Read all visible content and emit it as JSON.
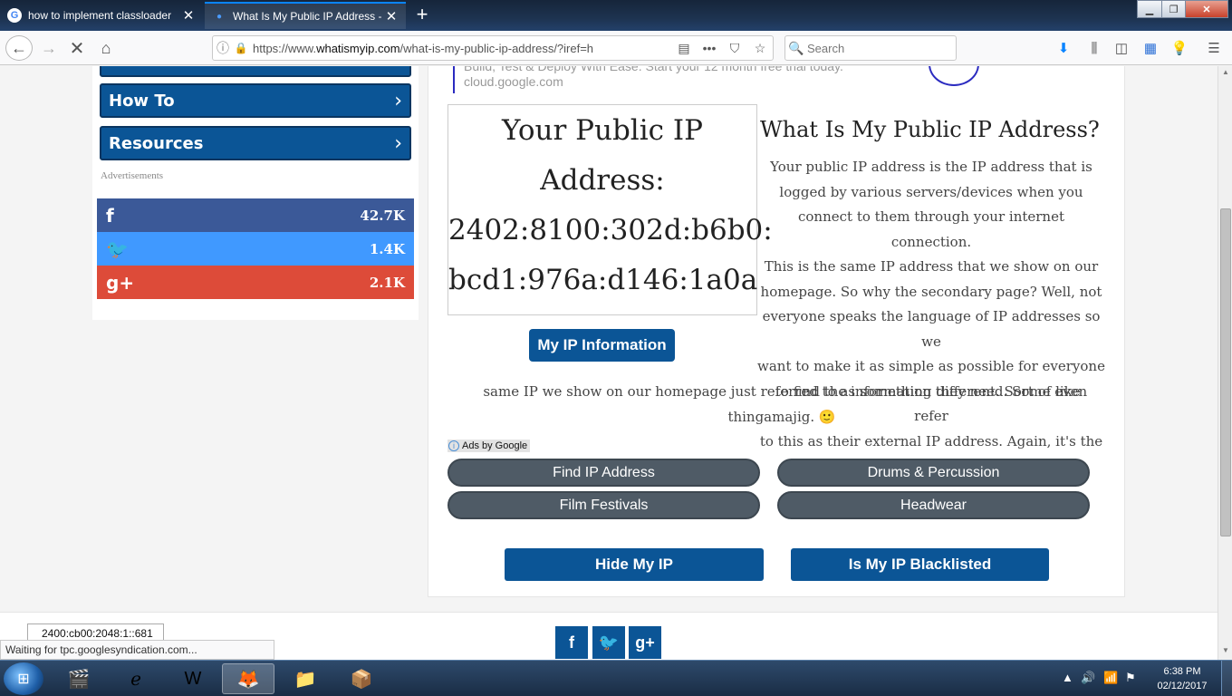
{
  "browser": {
    "tabs": [
      {
        "title": "how to implement classloader",
        "favicon": "G",
        "active": false
      },
      {
        "title": "What Is My Public IP Address -",
        "active": true
      }
    ],
    "url_prefix": "https://www.",
    "url_domain": "whatismyip.com",
    "url_rest": "/what-is-my-public-ip-address/?iref=h",
    "search_placeholder": "Search",
    "more_icon": "•••",
    "status_text": "Waiting for tpc.googlesyndication.com..."
  },
  "sidebar": {
    "nav_items": [
      {
        "label": "How To"
      },
      {
        "label": "Resources"
      }
    ],
    "ads_label": "Advertisements",
    "share": [
      {
        "network": "facebook",
        "icon": "f",
        "count": "42.7K",
        "color": "#3b5998"
      },
      {
        "network": "twitter",
        "icon": "🐦",
        "count": "1.4K",
        "color": "#4099ff"
      },
      {
        "network": "google-plus",
        "icon": "g+",
        "count": "2.1K",
        "color": "#dd4b39"
      }
    ]
  },
  "main": {
    "top_ad": {
      "line1": "Build, Test & Deploy With Ease. Start your 12 month free trial today.",
      "line2": "cloud.google.com"
    },
    "ip_box": {
      "line1": "Your Public IP",
      "line2": "Address:",
      "line3": "2402:8100:302d:b6b0:",
      "line4": "bcd1:976a:d146:1a0a"
    },
    "my_ip_button": "My IP Information",
    "heading": "What Is My Public IP Address?",
    "para_lines_a": [
      "Your public IP address is the IP address that is",
      "logged by various servers/devices when you",
      "connect to them through your internet connection.",
      "This is the same IP address that we show on our",
      "homepage. So why the secondary page? Well, not",
      "everyone speaks the language of IP addresses so we",
      "want to make it as simple as possible for everyone",
      "to find the information they need. Some even refer",
      "to this as their external IP address. Again, it's the"
    ],
    "para_lines_b": [
      "same IP we show on our homepage just referred to as something different. Sort of like",
      "thingamajig. 🙂"
    ],
    "ads_by": "Ads by Google",
    "ad_links": [
      "Find IP Address",
      "Drums & Percussion",
      "Film Festivals",
      "Headwear"
    ],
    "buttons": [
      "Hide My IP",
      "Is My IP Blacklisted"
    ]
  },
  "footer": {
    "ipv6_tooltip": "2400:cb00:2048:1::681",
    "social": [
      "f",
      "🐦",
      "g+"
    ]
  },
  "taskbar": {
    "time": "6:38 PM",
    "date": "02/12/2017"
  }
}
